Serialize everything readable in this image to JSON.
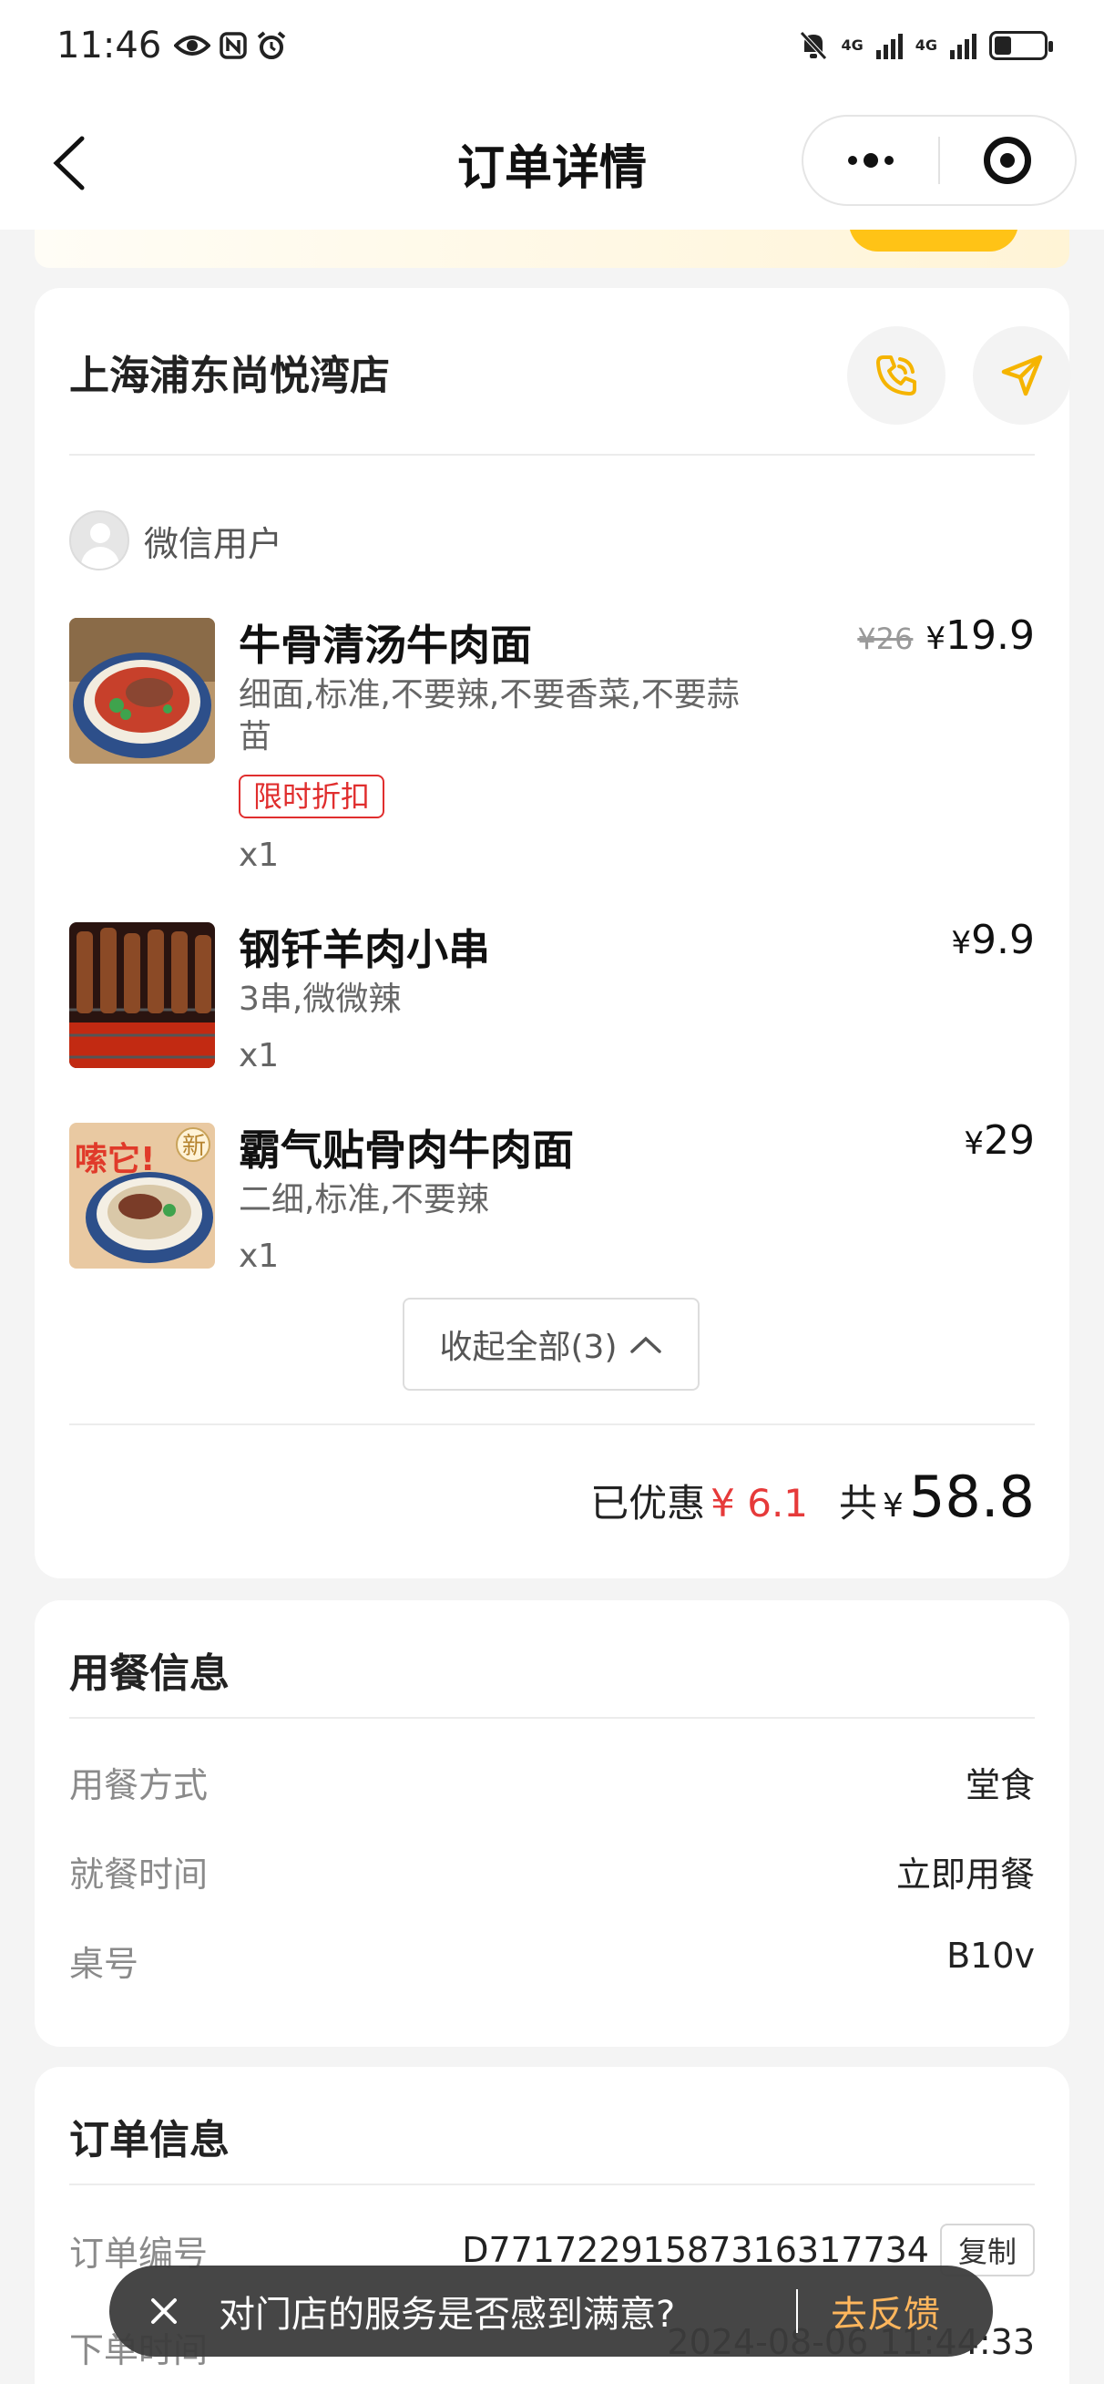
{
  "status_bar": {
    "time": "11:46",
    "network_1": "4G",
    "network_2": "4G"
  },
  "nav": {
    "title": "订单详情"
  },
  "store": {
    "name": "上海浦东尚悦湾店"
  },
  "user": {
    "name": "微信用户"
  },
  "items": [
    {
      "name": "牛骨清汤牛肉面",
      "spec": "细面,标准,不要辣,不要香菜,不要蒜苗",
      "tag": "限时折扣",
      "qty": "x1",
      "original_price": "¥26",
      "price": "19.9",
      "currency": "¥"
    },
    {
      "name": "钢钎羊肉小串",
      "spec": "3串,微微辣",
      "qty": "x1",
      "price": "9.9",
      "currency": "¥"
    },
    {
      "name": "霸气贴骨肉牛肉面",
      "spec": "二细,标准,不要辣",
      "qty": "x1",
      "price": "29",
      "currency": "¥",
      "image_text": "嗦它!",
      "image_badge": "新"
    }
  ],
  "collapse_label": "收起全部(3)",
  "totals": {
    "discount_label": "已优惠",
    "discount_value": "¥ 6.1",
    "sum_label": "共",
    "currency": "¥",
    "sum_value": "58.8"
  },
  "dining": {
    "title": "用餐信息",
    "rows": [
      {
        "key": "用餐方式",
        "value": "堂食"
      },
      {
        "key": "就餐时间",
        "value": "立即用餐"
      },
      {
        "key": "桌号",
        "value": "B10v"
      }
    ]
  },
  "order_info": {
    "title": "订单信息",
    "order_no_label": "订单编号",
    "order_no": "D77172291587316317734",
    "copy_label": "复制",
    "order_time_label": "下单时间",
    "order_time": "2024-08-06 11:44:33"
  },
  "toast": {
    "text": "对门店的服务是否感到满意?",
    "action": "去反馈"
  },
  "colors": {
    "accent_yellow": "#ffc316",
    "icon_yellow": "#f5b400",
    "price_red": "#e63a3a"
  }
}
